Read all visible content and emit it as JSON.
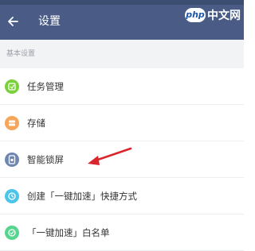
{
  "header": {
    "title": "设置",
    "back_icon": "back-arrow-icon"
  },
  "watermark": {
    "logo": "php",
    "text": "中文网"
  },
  "section": {
    "label": "基本设置"
  },
  "items": [
    {
      "label": "任务管理",
      "icon": "task-icon",
      "color": "#7bd13a"
    },
    {
      "label": "存储",
      "icon": "storage-icon",
      "color": "#f7a55a"
    },
    {
      "label": "智能锁屏",
      "icon": "lock-icon",
      "color": "#6f86b0"
    },
    {
      "label": "创建「一键加速」快捷方式",
      "icon": "shortcut-icon",
      "color": "#4cc5e8"
    },
    {
      "label": "「一键加速」白名单",
      "icon": "whitelist-icon",
      "color": "#57d48e"
    }
  ],
  "colors": {
    "header_bg": "#4a5c86",
    "annotation_arrow": "#d9252b"
  }
}
